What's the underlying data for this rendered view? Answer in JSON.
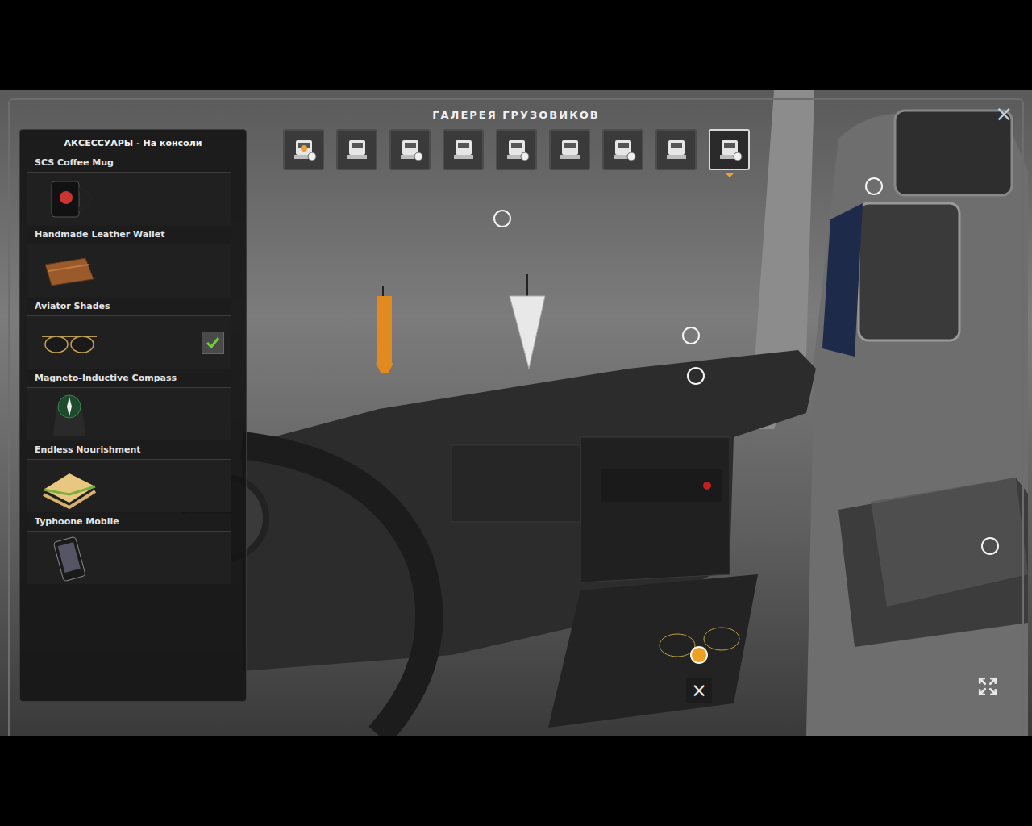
{
  "window": {
    "title": "ГАЛЕРЕЯ ГРУЗОВИКОВ",
    "close": "×"
  },
  "toolbar": [
    {
      "selected": false
    },
    {
      "selected": false
    },
    {
      "selected": false
    },
    {
      "selected": false
    },
    {
      "selected": false
    },
    {
      "selected": false
    },
    {
      "selected": false
    },
    {
      "selected": false
    },
    {
      "selected": true
    }
  ],
  "panel": {
    "title": "АКСЕССУАРЫ - На консоли",
    "items": [
      {
        "label": "SCS Coffee Mug",
        "selected": false,
        "checked": false
      },
      {
        "label": "Handmade Leather Wallet",
        "selected": false,
        "checked": false
      },
      {
        "label": "Aviator Shades",
        "selected": true,
        "checked": true
      },
      {
        "label": "Magneto-Inductive Compass",
        "selected": false,
        "checked": false
      },
      {
        "label": "Endless Nourishment",
        "selected": false,
        "checked": false
      },
      {
        "label": "Typhoone Mobile",
        "selected": false,
        "checked": false
      }
    ]
  },
  "hotspots": [
    {
      "selected": false
    },
    {
      "selected": false
    },
    {
      "selected": false
    },
    {
      "selected": false
    },
    {
      "selected": false
    },
    {
      "selected": true
    }
  ],
  "remove_button": "×"
}
